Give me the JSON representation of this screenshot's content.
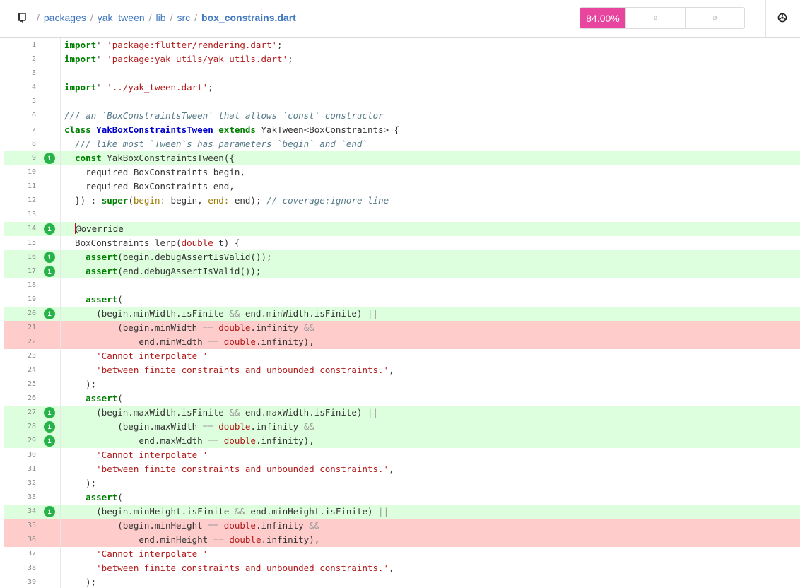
{
  "header": {
    "breadcrumb": [
      "packages",
      "yak_tween",
      "lib",
      "src"
    ],
    "current_file": "box_constrains.dart",
    "separator": "/",
    "coverage_percent": "84.00%",
    "coverage_cell_2": "ø",
    "coverage_cell_3": "ø",
    "icons": [
      "repo-icon",
      "settings-icon"
    ]
  },
  "colors": {
    "covered": "#ddffdd",
    "uncovered": "#ffcccc",
    "badge": "#e8459f",
    "hit_dot": "#27b34a"
  },
  "lines": [
    {
      "n": "1",
      "status": "none",
      "hits": "",
      "code": [
        [
          "kw2",
          "import"
        ],
        [
          "",
          "' "
        ],
        [
          "str",
          "'package:flutter/rendering.dart'"
        ],
        [
          "",
          ";"
        ]
      ]
    },
    {
      "n": "2",
      "status": "none",
      "hits": "",
      "code": [
        [
          "kw2",
          "import"
        ],
        [
          "",
          "' "
        ],
        [
          "str",
          "'package:yak_utils/yak_utils.dart'"
        ],
        [
          "",
          ";"
        ]
      ]
    },
    {
      "n": "3",
      "status": "none",
      "hits": "",
      "code": []
    },
    {
      "n": "4",
      "status": "none",
      "hits": "",
      "code": [
        [
          "kw2",
          "import"
        ],
        [
          "",
          "' "
        ],
        [
          "str",
          "'../yak_tween.dart'"
        ],
        [
          "",
          ";"
        ]
      ]
    },
    {
      "n": "5",
      "status": "none",
      "hits": "",
      "code": []
    },
    {
      "n": "6",
      "status": "none",
      "hits": "",
      "code": [
        [
          "cm",
          "/// an `BoxConstraintsTween` that allows `const` constructor"
        ]
      ]
    },
    {
      "n": "7",
      "status": "none",
      "hits": "",
      "code": [
        [
          "kw2",
          "class"
        ],
        [
          "",
          " "
        ],
        [
          "cls",
          "YakBoxConstraintsTween"
        ],
        [
          "",
          " "
        ],
        [
          "kw2",
          "extends"
        ],
        [
          "",
          " YakTween<BoxConstraints> {"
        ]
      ]
    },
    {
      "n": "8",
      "status": "none",
      "hits": "",
      "code": [
        [
          "",
          "  "
        ],
        [
          "cm",
          "/// like most `Tween`s has parameters `begin` and `end`"
        ]
      ]
    },
    {
      "n": "9",
      "status": "hit",
      "hits": "1",
      "code": [
        [
          "",
          "  "
        ],
        [
          "kw2",
          "const"
        ],
        [
          "",
          " YakBoxConstraintsTween({"
        ]
      ]
    },
    {
      "n": "10",
      "status": "none",
      "hits": "",
      "code": [
        [
          "",
          "    required BoxConstraints begin,"
        ]
      ]
    },
    {
      "n": "11",
      "status": "none",
      "hits": "",
      "code": [
        [
          "",
          "    required BoxConstraints end,"
        ]
      ]
    },
    {
      "n": "12",
      "status": "none",
      "hits": "",
      "code": [
        [
          "",
          "  }) : "
        ],
        [
          "kw2",
          "super"
        ],
        [
          "",
          "("
        ],
        [
          "pn",
          "begin:"
        ],
        [
          "",
          " begin, "
        ],
        [
          "pn",
          "end:"
        ],
        [
          "",
          " end); "
        ],
        [
          "cm",
          "// coverage:ignore-line"
        ]
      ]
    },
    {
      "n": "13",
      "status": "none",
      "hits": "",
      "code": []
    },
    {
      "n": "14",
      "status": "hit",
      "hits": "1",
      "code": [
        [
          "",
          "  "
        ],
        [
          "cursor",
          "@"
        ],
        [
          "",
          "override"
        ]
      ]
    },
    {
      "n": "15",
      "status": "none",
      "hits": "",
      "code": [
        [
          "",
          "  BoxConstraints lerp("
        ],
        [
          "ty",
          "double"
        ],
        [
          "",
          " t) {"
        ]
      ]
    },
    {
      "n": "16",
      "status": "hit",
      "hits": "1",
      "code": [
        [
          "",
          "    "
        ],
        [
          "kw2",
          "assert"
        ],
        [
          "",
          "(begin.debugAssertIsValid());"
        ]
      ]
    },
    {
      "n": "17",
      "status": "hit",
      "hits": "1",
      "code": [
        [
          "",
          "    "
        ],
        [
          "kw2",
          "assert"
        ],
        [
          "",
          "(end.debugAssertIsValid());"
        ]
      ]
    },
    {
      "n": "18",
      "status": "none",
      "hits": "",
      "code": []
    },
    {
      "n": "19",
      "status": "none",
      "hits": "",
      "code": [
        [
          "",
          "    "
        ],
        [
          "kw2",
          "assert"
        ],
        [
          "",
          "("
        ]
      ]
    },
    {
      "n": "20",
      "status": "hit",
      "hits": "1",
      "code": [
        [
          "",
          "      (begin.minWidth.isFinite "
        ],
        [
          "op",
          "&&"
        ],
        [
          "",
          " end.minWidth.isFinite) "
        ],
        [
          "op",
          "||"
        ]
      ]
    },
    {
      "n": "21",
      "status": "miss",
      "hits": "",
      "code": [
        [
          "",
          "          (begin.minWidth "
        ],
        [
          "op",
          "=="
        ],
        [
          "",
          " "
        ],
        [
          "ty",
          "double"
        ],
        [
          "",
          ".infinity "
        ],
        [
          "op",
          "&&"
        ]
      ]
    },
    {
      "n": "22",
      "status": "miss",
      "hits": "",
      "code": [
        [
          "",
          "              end.minWidth "
        ],
        [
          "op",
          "=="
        ],
        [
          "",
          " "
        ],
        [
          "ty",
          "double"
        ],
        [
          "",
          ".infinity),"
        ]
      ]
    },
    {
      "n": "23",
      "status": "none",
      "hits": "",
      "code": [
        [
          "",
          "      "
        ],
        [
          "str",
          "'Cannot interpolate '"
        ]
      ]
    },
    {
      "n": "24",
      "status": "none",
      "hits": "",
      "code": [
        [
          "",
          "      "
        ],
        [
          "str",
          "'between finite constraints and unbounded constraints.'"
        ],
        [
          "",
          ","
        ]
      ]
    },
    {
      "n": "25",
      "status": "none",
      "hits": "",
      "code": [
        [
          "",
          "    );"
        ]
      ]
    },
    {
      "n": "26",
      "status": "none",
      "hits": "",
      "code": [
        [
          "",
          "    "
        ],
        [
          "kw2",
          "assert"
        ],
        [
          "",
          "("
        ]
      ]
    },
    {
      "n": "27",
      "status": "hit",
      "hits": "1",
      "code": [
        [
          "",
          "      (begin.maxWidth.isFinite "
        ],
        [
          "op",
          "&&"
        ],
        [
          "",
          " end.maxWidth.isFinite) "
        ],
        [
          "op",
          "||"
        ]
      ]
    },
    {
      "n": "28",
      "status": "hit",
      "hits": "1",
      "code": [
        [
          "",
          "          (begin.maxWidth "
        ],
        [
          "op",
          "=="
        ],
        [
          "",
          " "
        ],
        [
          "ty",
          "double"
        ],
        [
          "",
          ".infinity "
        ],
        [
          "op",
          "&&"
        ]
      ]
    },
    {
      "n": "29",
      "status": "hit",
      "hits": "1",
      "code": [
        [
          "",
          "              end.maxWidth "
        ],
        [
          "op",
          "=="
        ],
        [
          "",
          " "
        ],
        [
          "ty",
          "double"
        ],
        [
          "",
          ".infinity),"
        ]
      ]
    },
    {
      "n": "30",
      "status": "none",
      "hits": "",
      "code": [
        [
          "",
          "      "
        ],
        [
          "str",
          "'Cannot interpolate '"
        ]
      ]
    },
    {
      "n": "31",
      "status": "none",
      "hits": "",
      "code": [
        [
          "",
          "      "
        ],
        [
          "str",
          "'between finite constraints and unbounded constraints.'"
        ],
        [
          "",
          ","
        ]
      ]
    },
    {
      "n": "32",
      "status": "none",
      "hits": "",
      "code": [
        [
          "",
          "    );"
        ]
      ]
    },
    {
      "n": "33",
      "status": "none",
      "hits": "",
      "code": [
        [
          "",
          "    "
        ],
        [
          "kw2",
          "assert"
        ],
        [
          "",
          "("
        ]
      ]
    },
    {
      "n": "34",
      "status": "hit",
      "hits": "1",
      "code": [
        [
          "",
          "      (begin.minHeight.isFinite "
        ],
        [
          "op",
          "&&"
        ],
        [
          "",
          " end.minHeight.isFinite) "
        ],
        [
          "op",
          "||"
        ]
      ]
    },
    {
      "n": "35",
      "status": "miss",
      "hits": "",
      "code": [
        [
          "",
          "          (begin.minHeight "
        ],
        [
          "op",
          "=="
        ],
        [
          "",
          " "
        ],
        [
          "ty",
          "double"
        ],
        [
          "",
          ".infinity "
        ],
        [
          "op",
          "&&"
        ]
      ]
    },
    {
      "n": "36",
      "status": "miss",
      "hits": "",
      "code": [
        [
          "",
          "              end.minHeight "
        ],
        [
          "op",
          "=="
        ],
        [
          "",
          " "
        ],
        [
          "ty",
          "double"
        ],
        [
          "",
          ".infinity),"
        ]
      ]
    },
    {
      "n": "37",
      "status": "none",
      "hits": "",
      "code": [
        [
          "",
          "      "
        ],
        [
          "str",
          "'Cannot interpolate '"
        ]
      ]
    },
    {
      "n": "38",
      "status": "none",
      "hits": "",
      "code": [
        [
          "",
          "      "
        ],
        [
          "str",
          "'between finite constraints and unbounded constraints.'"
        ],
        [
          "",
          ","
        ]
      ]
    },
    {
      "n": "39",
      "status": "none",
      "hits": "",
      "code": [
        [
          "",
          "    );"
        ]
      ]
    }
  ]
}
